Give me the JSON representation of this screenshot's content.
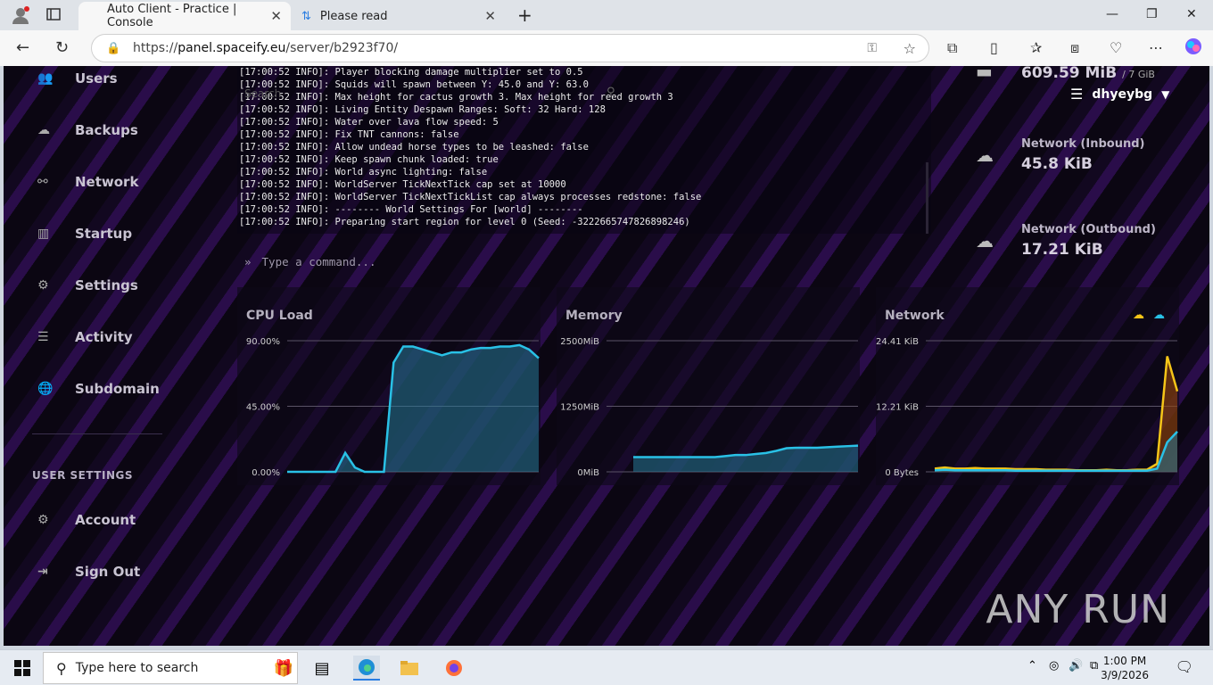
{
  "browser": {
    "tabs": [
      {
        "label": "Auto Client - Practice | Console"
      },
      {
        "label": "Please read"
      }
    ],
    "url_prefix": "https://",
    "url_host": "panel.spaceify.eu",
    "url_path": "/server/b2923f70/"
  },
  "sidebar": {
    "items": [
      {
        "label": "Users",
        "icon": "users-icon"
      },
      {
        "label": "Backups",
        "icon": "cloud-icon"
      },
      {
        "label": "Network",
        "icon": "network-icon"
      },
      {
        "label": "Startup",
        "icon": "chart-icon"
      },
      {
        "label": "Settings",
        "icon": "gears-icon"
      },
      {
        "label": "Activity",
        "icon": "list-icon"
      },
      {
        "label": "Subdomain",
        "icon": "globe-icon"
      }
    ],
    "user_settings_label": "USER SETTINGS",
    "user_items": [
      {
        "label": "Account"
      },
      {
        "label": "Sign Out"
      }
    ]
  },
  "console": {
    "lines": [
      "[17:00:52 INFO]: Player blocking damage multiplier set to 0.5",
      "[17:00:52 INFO]: Squids will spawn between Y: 45.0 and Y: 63.0",
      "[17:00:52 INFO]: Max height for cactus growth 3. Max height for reed growth 3",
      "[17:00:52 INFO]: Living Entity Despawn Ranges:  Soft: 32 Hard: 128",
      "[17:00:52 INFO]: Water over lava flow speed: 5",
      "[17:00:52 INFO]: Fix TNT cannons: false",
      "[17:00:52 INFO]: Allow undead horse types to be leashed: false",
      "[17:00:52 INFO]: Keep spawn chunk loaded: true",
      "[17:00:52 INFO]: World async lighting: false",
      "[17:00:52 INFO]: WorldServer TickNextTick cap set at 10000",
      "[17:00:52 INFO]: WorldServer TickNextTickList cap always processes redstone: false",
      "[17:00:52 INFO]: -------- World Settings For [world] --------",
      "[17:00:52 INFO]: Preparing start region for level 0 (Seed: -3222665747826898246)"
    ],
    "search_ghost": "Search",
    "input_placeholder": "Type a command..."
  },
  "stats": {
    "memory_value": "609.59 MiB",
    "memory_limit": "/ 7 GiB",
    "net_in_label": "Network (Inbound)",
    "net_in_value": "45.8 KiB",
    "net_out_label": "Network (Outbound)",
    "net_out_value": "17.21 KiB"
  },
  "user": {
    "name": "dhyeybg"
  },
  "charts": {
    "cpu": {
      "title": "CPU Load",
      "ticks": [
        "90.00%",
        "45.00%",
        "0.00%"
      ]
    },
    "memory": {
      "title": "Memory",
      "ticks": [
        "2500MiB",
        "1250MiB",
        "0MiB"
      ]
    },
    "network": {
      "title": "Network",
      "ticks": [
        "24.41 KiB",
        "12.21 KiB",
        "0 Bytes"
      ]
    }
  },
  "chart_data": [
    {
      "type": "area",
      "title": "CPU Load",
      "ylim": [
        0,
        90
      ],
      "series": [
        {
          "values": [
            0,
            0,
            0,
            0,
            0,
            0,
            13,
            3,
            0,
            0,
            0,
            75,
            86,
            86,
            84,
            82,
            80,
            82,
            82,
            84,
            85,
            85,
            86,
            86,
            87,
            84,
            78
          ]
        }
      ]
    },
    {
      "type": "area",
      "title": "Memory",
      "ylim": [
        0,
        2500
      ],
      "series": [
        {
          "values": [
            280,
            280,
            280,
            280,
            280,
            280,
            280,
            280,
            280,
            300,
            320,
            320,
            340,
            360,
            400,
            450,
            460,
            460,
            460,
            470,
            480,
            490,
            500
          ]
        }
      ]
    },
    {
      "type": "area",
      "title": "Network",
      "ylim": [
        0,
        24.41
      ],
      "series": [
        {
          "name": "inbound",
          "color": "#f5c518",
          "values": [
            0.6,
            0.8,
            0.6,
            0.6,
            0.7,
            0.6,
            0.6,
            0.6,
            0.5,
            0.5,
            0.5,
            0.4,
            0.4,
            0.4,
            0.3,
            0.3,
            0.3,
            0.4,
            0.3,
            0.3,
            0.4,
            0.4,
            1.5,
            21.5,
            15
          ]
        },
        {
          "name": "outbound",
          "color": "#29c1e6",
          "values": [
            0.3,
            0.4,
            0.3,
            0.3,
            0.3,
            0.3,
            0.3,
            0.3,
            0.2,
            0.2,
            0.2,
            0.2,
            0.2,
            0.2,
            0.2,
            0.2,
            0.2,
            0.2,
            0.2,
            0.2,
            0.2,
            0.2,
            0.6,
            5.5,
            7.5
          ]
        }
      ]
    }
  ],
  "watermark": "ANY RUN",
  "taskbar": {
    "search_placeholder": "Type here to search",
    "time": "1:00 PM",
    "date": "3/9/2026"
  }
}
